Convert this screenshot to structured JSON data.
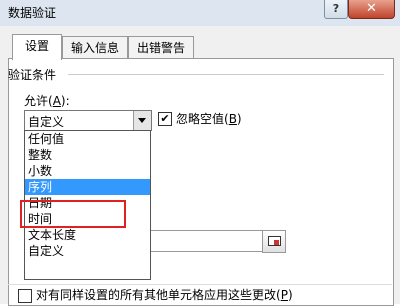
{
  "window": {
    "title": "数据验证",
    "help_label": "?",
    "close_label": "✕"
  },
  "tabs": [
    {
      "label": "设置",
      "active": true
    },
    {
      "label": "输入信息",
      "active": false
    },
    {
      "label": "出错警告",
      "active": false
    }
  ],
  "validation": {
    "group_label": "验证条件",
    "allow_label": "允许(",
    "allow_key": "A",
    "allow_suffix": "):",
    "allow_value": "自定义",
    "ignore_blank_label": "忽略空值(",
    "ignore_blank_key": "B",
    "ignore_blank_suffix": ")",
    "ignore_blank_checked": true
  },
  "dropdown": {
    "options": [
      "任何值",
      "整数",
      "小数",
      "序列",
      "日期",
      "时间",
      "文本长度",
      "自定义"
    ],
    "selected_index": 3
  },
  "footer": {
    "apply_all_label": "对有同样设置的所有其他单元格应用这些更改(",
    "apply_all_key": "P",
    "apply_all_suffix": ")",
    "apply_all_checked": false
  },
  "colors": {
    "selection": "#3399ff",
    "highlight_border": "#dd2222"
  }
}
